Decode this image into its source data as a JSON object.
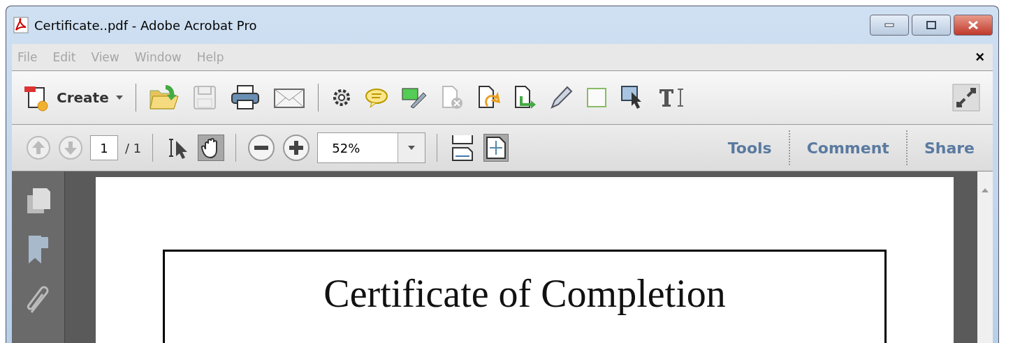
{
  "window": {
    "title": "Certificate..pdf - Adobe Acrobat Pro"
  },
  "menu": [
    "File",
    "Edit",
    "View",
    "Window",
    "Help"
  ],
  "menu_close": "×",
  "toolbar": {
    "create_label": "Create"
  },
  "nav": {
    "page": "1",
    "page_total": "/ 1",
    "zoom": "52%"
  },
  "view_tools": [
    {
      "kind": "select",
      "selected": false
    },
    {
      "kind": "hand",
      "selected": true
    }
  ],
  "page_views": [
    {
      "kind": "scroll",
      "selected": false
    },
    {
      "kind": "fit",
      "selected": true
    }
  ],
  "panes": [
    {
      "label": "Tools"
    },
    {
      "label": "Comment"
    },
    {
      "label": "Share"
    }
  ],
  "document": {
    "heading": "Certificate of Completion"
  }
}
